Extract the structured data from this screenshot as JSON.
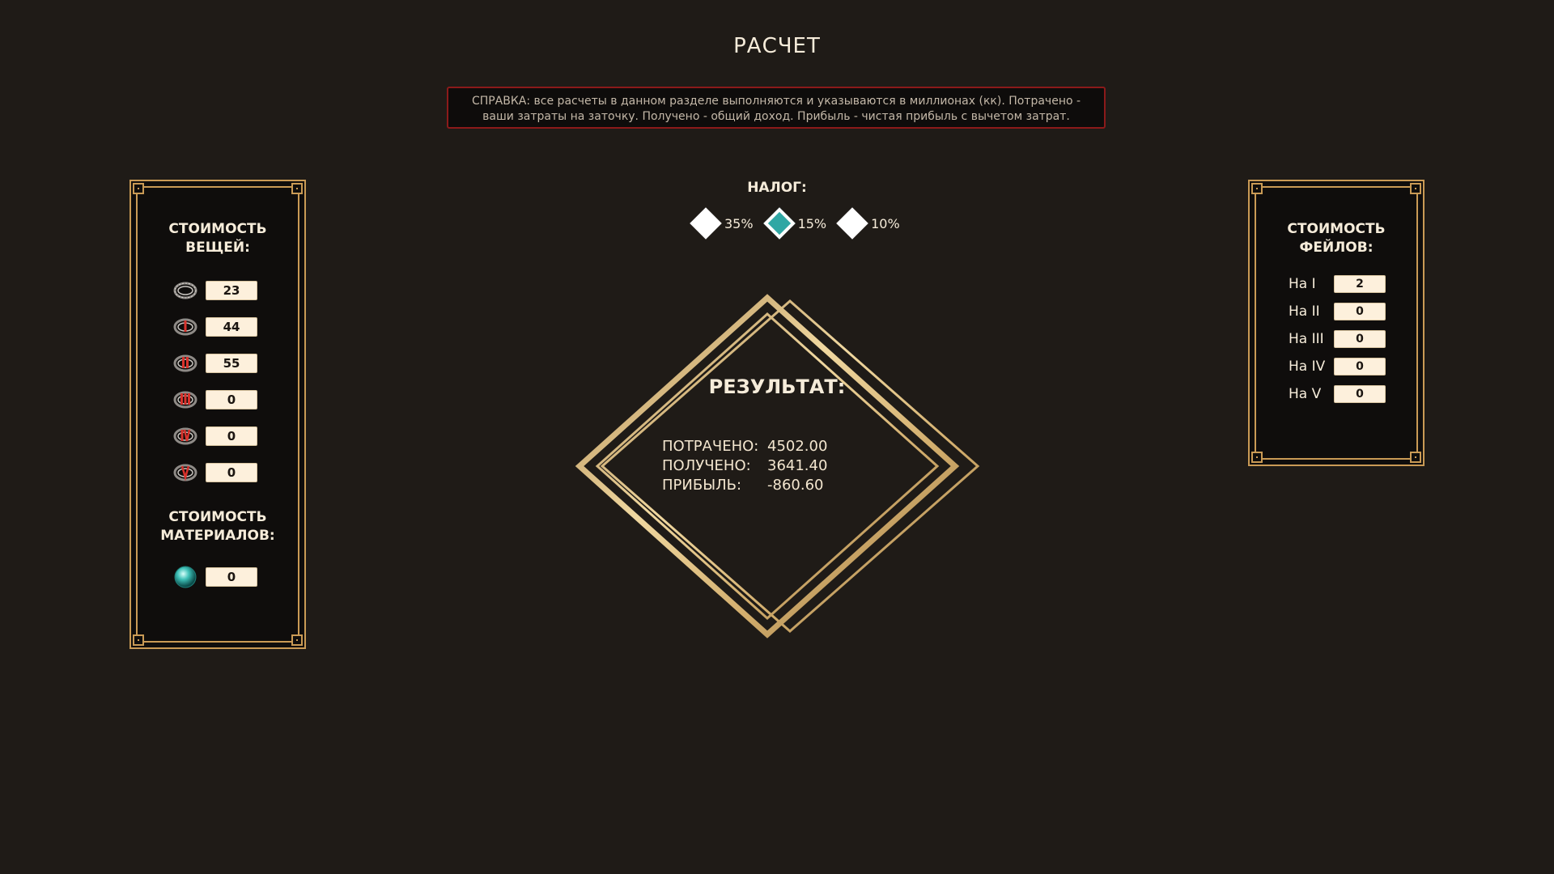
{
  "page": {
    "title": "РАСЧЕТ",
    "help_text": "СПРАВКА: все расчеты в данном разделе выполняются и указываются в миллионах (кк). Потрачено - ваши затраты на заточку. Получено - общий доход. Прибыль - чистая прибыль с вычетом затрат."
  },
  "items_panel": {
    "heading": "СТОИМОСТЬ ВЕЩЕЙ:",
    "items": [
      {
        "icon": "ring-base-icon",
        "value": "23"
      },
      {
        "icon": "ring-grade-i-icon",
        "value": "44"
      },
      {
        "icon": "ring-grade-ii-icon",
        "value": "55"
      },
      {
        "icon": "ring-grade-iii-icon",
        "value": "0"
      },
      {
        "icon": "ring-grade-iv-icon",
        "value": "0"
      },
      {
        "icon": "ring-grade-v-icon",
        "value": "0"
      }
    ],
    "materials_heading": "СТОИМОСТЬ МАТЕРИАЛОВ:",
    "material": {
      "icon": "orb-icon",
      "value": "0"
    }
  },
  "tax": {
    "label": "НАЛОГ:",
    "options": [
      {
        "label": "35%",
        "selected": false
      },
      {
        "label": "15%",
        "selected": true
      },
      {
        "label": "10%",
        "selected": false
      }
    ],
    "selected_color": "#2fa7a4"
  },
  "result": {
    "title": "РЕЗУЛЬТАТ:",
    "spent_label": "ПОТРАЧЕНО:",
    "spent_value": "4502.00",
    "received_label": "ПОЛУЧЕНО:",
    "received_value": "3641.40",
    "profit_label": "ПРИБЫЛЬ:",
    "profit_value": "-860.60"
  },
  "fails_panel": {
    "heading": "СТОИМОСТЬ ФЕЙЛОВ:",
    "rows": [
      {
        "label": "На I",
        "value": "2"
      },
      {
        "label": "На II",
        "value": "0"
      },
      {
        "label": "На III",
        "value": "0"
      },
      {
        "label": "На IV",
        "value": "0"
      },
      {
        "label": "На V",
        "value": "0"
      }
    ]
  },
  "colors": {
    "background": "#1f1b17",
    "gold": "#c99a55",
    "help_border": "#8b1a1a",
    "input_bg": "#fdf0dc"
  }
}
